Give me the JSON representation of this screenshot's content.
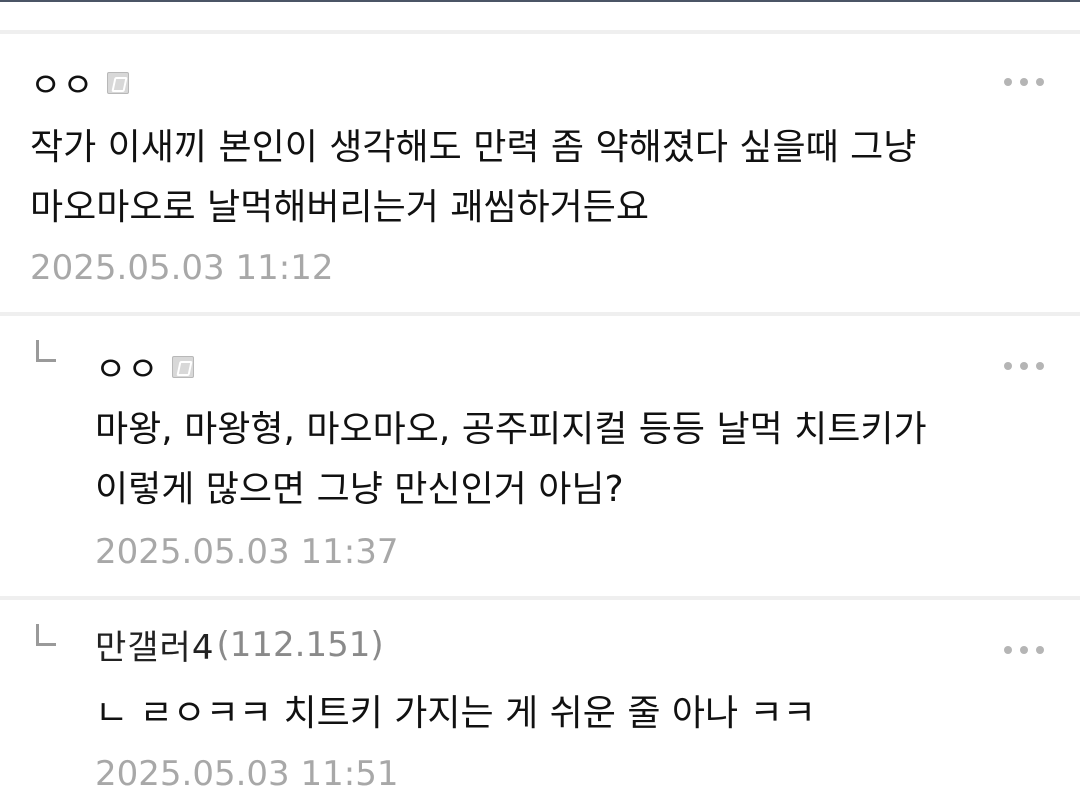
{
  "comments": [
    {
      "nickname": "ㅇㅇ",
      "fixed_icon": "fixed-nick-icon",
      "text_lines": [
        "작가 이새끼 본인이 생각해도 만력 좀 약해졌다 싶을때 그냥",
        "마오마오로 날먹해버리는거 괘씸하거든요"
      ],
      "date": "2025.05.03 11:12",
      "menu_icon": "more-dots-icon"
    },
    {
      "nickname": "ㅇㅇ",
      "fixed_icon": "fixed-nick-icon",
      "reply_icon": "reply-arrow-icon",
      "text_lines": [
        "마왕, 마왕형, 마오마오, 공주피지컬 등등 날먹 치트키가",
        "이렇게 많으면 그냥 만신인거 아님?"
      ],
      "date": "2025.05.03 11:37",
      "menu_icon": "more-dots-icon"
    },
    {
      "nickname": "만갤러4",
      "ip": "(112.151)",
      "reply_icon": "reply-arrow-icon",
      "text_lines": [
        "ㄴ ㄹㅇㅋㅋ 치트키 가지는 게 쉬운 줄 아나 ㅋㅋ"
      ],
      "date": "2025.05.03 11:51",
      "menu_icon": "more-dots-icon"
    }
  ]
}
